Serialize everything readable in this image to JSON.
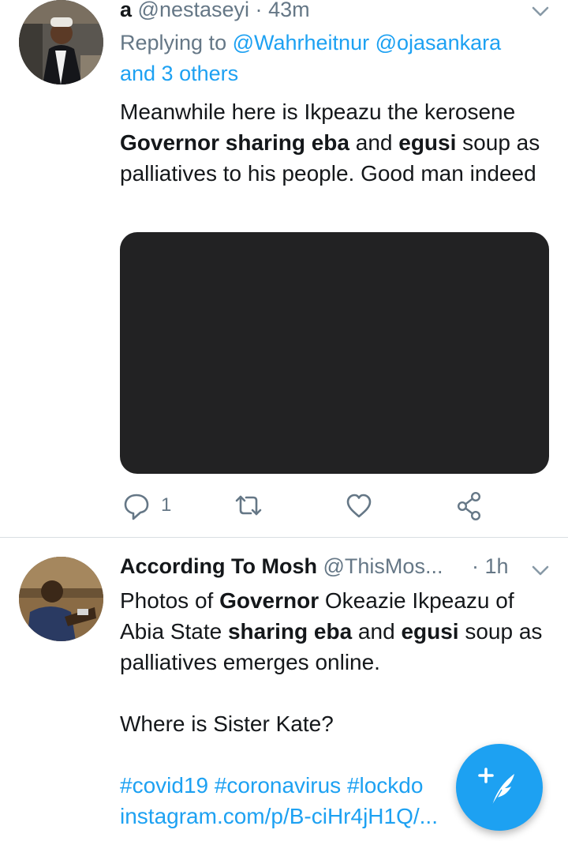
{
  "tweets": [
    {
      "display_name": "a",
      "handle": "@nestaseyi",
      "separator": "·",
      "time": "43m",
      "reply_prefix": "Replying to",
      "reply_mention_1": "@Wahrheitnur",
      "reply_mention_2": "@ojasankara",
      "reply_suffix": "and 3 others",
      "text_parts": [
        "Meanwhile here is Ikpeazu the kerosene ",
        "Governor sharing eba",
        " and ",
        "egusi",
        " soup as palliatives to his people. Good man indeed"
      ],
      "reply_count": "1"
    },
    {
      "display_name": "According To Mosh",
      "handle": "@ThisMos...",
      "separator": "·",
      "time": "1h",
      "text_parts": [
        "Photos of ",
        "Governor",
        " Okeazie Ikpeazu of Abia State ",
        "sharing eba",
        " and ",
        "egusi",
        " soup as palliatives emerges online."
      ],
      "text_line_2": "Where is Sister Kate?",
      "hashtags": "#covid19 #coronavirus #lockdo",
      "link": "instagram.com/p/B-ciHr4jH1Q/..."
    }
  ],
  "icons": {
    "reply": "reply-icon",
    "retweet": "retweet-icon",
    "like": "heart-icon",
    "share": "share-icon",
    "menu": "chevron-down-icon",
    "compose": "compose-tweet-icon"
  },
  "colors": {
    "accent": "#1da1f2",
    "text_primary": "#14171a",
    "text_secondary": "#657786",
    "media_placeholder": "#222223",
    "divider": "#d9dee2"
  }
}
